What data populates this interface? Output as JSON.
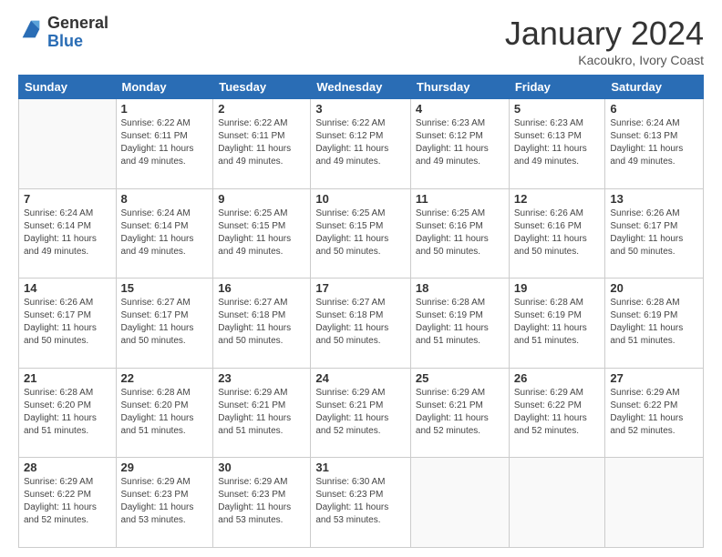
{
  "logo": {
    "general": "General",
    "blue": "Blue"
  },
  "header": {
    "month": "January 2024",
    "location": "Kacoukro, Ivory Coast"
  },
  "weekdays": [
    "Sunday",
    "Monday",
    "Tuesday",
    "Wednesday",
    "Thursday",
    "Friday",
    "Saturday"
  ],
  "weeks": [
    [
      {
        "day": "",
        "sunrise": "",
        "sunset": "",
        "daylight": ""
      },
      {
        "day": "1",
        "sunrise": "Sunrise: 6:22 AM",
        "sunset": "Sunset: 6:11 PM",
        "daylight": "Daylight: 11 hours and 49 minutes."
      },
      {
        "day": "2",
        "sunrise": "Sunrise: 6:22 AM",
        "sunset": "Sunset: 6:11 PM",
        "daylight": "Daylight: 11 hours and 49 minutes."
      },
      {
        "day": "3",
        "sunrise": "Sunrise: 6:22 AM",
        "sunset": "Sunset: 6:12 PM",
        "daylight": "Daylight: 11 hours and 49 minutes."
      },
      {
        "day": "4",
        "sunrise": "Sunrise: 6:23 AM",
        "sunset": "Sunset: 6:12 PM",
        "daylight": "Daylight: 11 hours and 49 minutes."
      },
      {
        "day": "5",
        "sunrise": "Sunrise: 6:23 AM",
        "sunset": "Sunset: 6:13 PM",
        "daylight": "Daylight: 11 hours and 49 minutes."
      },
      {
        "day": "6",
        "sunrise": "Sunrise: 6:24 AM",
        "sunset": "Sunset: 6:13 PM",
        "daylight": "Daylight: 11 hours and 49 minutes."
      }
    ],
    [
      {
        "day": "7",
        "sunrise": "Sunrise: 6:24 AM",
        "sunset": "Sunset: 6:14 PM",
        "daylight": "Daylight: 11 hours and 49 minutes."
      },
      {
        "day": "8",
        "sunrise": "Sunrise: 6:24 AM",
        "sunset": "Sunset: 6:14 PM",
        "daylight": "Daylight: 11 hours and 49 minutes."
      },
      {
        "day": "9",
        "sunrise": "Sunrise: 6:25 AM",
        "sunset": "Sunset: 6:15 PM",
        "daylight": "Daylight: 11 hours and 49 minutes."
      },
      {
        "day": "10",
        "sunrise": "Sunrise: 6:25 AM",
        "sunset": "Sunset: 6:15 PM",
        "daylight": "Daylight: 11 hours and 50 minutes."
      },
      {
        "day": "11",
        "sunrise": "Sunrise: 6:25 AM",
        "sunset": "Sunset: 6:16 PM",
        "daylight": "Daylight: 11 hours and 50 minutes."
      },
      {
        "day": "12",
        "sunrise": "Sunrise: 6:26 AM",
        "sunset": "Sunset: 6:16 PM",
        "daylight": "Daylight: 11 hours and 50 minutes."
      },
      {
        "day": "13",
        "sunrise": "Sunrise: 6:26 AM",
        "sunset": "Sunset: 6:17 PM",
        "daylight": "Daylight: 11 hours and 50 minutes."
      }
    ],
    [
      {
        "day": "14",
        "sunrise": "Sunrise: 6:26 AM",
        "sunset": "Sunset: 6:17 PM",
        "daylight": "Daylight: 11 hours and 50 minutes."
      },
      {
        "day": "15",
        "sunrise": "Sunrise: 6:27 AM",
        "sunset": "Sunset: 6:17 PM",
        "daylight": "Daylight: 11 hours and 50 minutes."
      },
      {
        "day": "16",
        "sunrise": "Sunrise: 6:27 AM",
        "sunset": "Sunset: 6:18 PM",
        "daylight": "Daylight: 11 hours and 50 minutes."
      },
      {
        "day": "17",
        "sunrise": "Sunrise: 6:27 AM",
        "sunset": "Sunset: 6:18 PM",
        "daylight": "Daylight: 11 hours and 50 minutes."
      },
      {
        "day": "18",
        "sunrise": "Sunrise: 6:28 AM",
        "sunset": "Sunset: 6:19 PM",
        "daylight": "Daylight: 11 hours and 51 minutes."
      },
      {
        "day": "19",
        "sunrise": "Sunrise: 6:28 AM",
        "sunset": "Sunset: 6:19 PM",
        "daylight": "Daylight: 11 hours and 51 minutes."
      },
      {
        "day": "20",
        "sunrise": "Sunrise: 6:28 AM",
        "sunset": "Sunset: 6:19 PM",
        "daylight": "Daylight: 11 hours and 51 minutes."
      }
    ],
    [
      {
        "day": "21",
        "sunrise": "Sunrise: 6:28 AM",
        "sunset": "Sunset: 6:20 PM",
        "daylight": "Daylight: 11 hours and 51 minutes."
      },
      {
        "day": "22",
        "sunrise": "Sunrise: 6:28 AM",
        "sunset": "Sunset: 6:20 PM",
        "daylight": "Daylight: 11 hours and 51 minutes."
      },
      {
        "day": "23",
        "sunrise": "Sunrise: 6:29 AM",
        "sunset": "Sunset: 6:21 PM",
        "daylight": "Daylight: 11 hours and 51 minutes."
      },
      {
        "day": "24",
        "sunrise": "Sunrise: 6:29 AM",
        "sunset": "Sunset: 6:21 PM",
        "daylight": "Daylight: 11 hours and 52 minutes."
      },
      {
        "day": "25",
        "sunrise": "Sunrise: 6:29 AM",
        "sunset": "Sunset: 6:21 PM",
        "daylight": "Daylight: 11 hours and 52 minutes."
      },
      {
        "day": "26",
        "sunrise": "Sunrise: 6:29 AM",
        "sunset": "Sunset: 6:22 PM",
        "daylight": "Daylight: 11 hours and 52 minutes."
      },
      {
        "day": "27",
        "sunrise": "Sunrise: 6:29 AM",
        "sunset": "Sunset: 6:22 PM",
        "daylight": "Daylight: 11 hours and 52 minutes."
      }
    ],
    [
      {
        "day": "28",
        "sunrise": "Sunrise: 6:29 AM",
        "sunset": "Sunset: 6:22 PM",
        "daylight": "Daylight: 11 hours and 52 minutes."
      },
      {
        "day": "29",
        "sunrise": "Sunrise: 6:29 AM",
        "sunset": "Sunset: 6:23 PM",
        "daylight": "Daylight: 11 hours and 53 minutes."
      },
      {
        "day": "30",
        "sunrise": "Sunrise: 6:29 AM",
        "sunset": "Sunset: 6:23 PM",
        "daylight": "Daylight: 11 hours and 53 minutes."
      },
      {
        "day": "31",
        "sunrise": "Sunrise: 6:30 AM",
        "sunset": "Sunset: 6:23 PM",
        "daylight": "Daylight: 11 hours and 53 minutes."
      },
      {
        "day": "",
        "sunrise": "",
        "sunset": "",
        "daylight": ""
      },
      {
        "day": "",
        "sunrise": "",
        "sunset": "",
        "daylight": ""
      },
      {
        "day": "",
        "sunrise": "",
        "sunset": "",
        "daylight": ""
      }
    ]
  ]
}
